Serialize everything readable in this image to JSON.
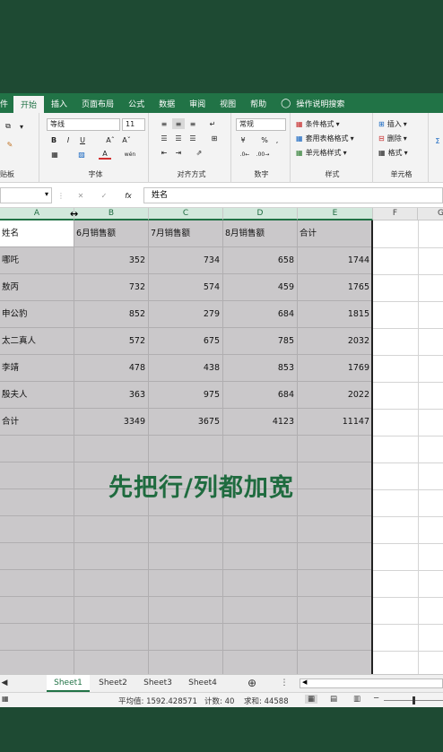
{
  "tabs": [
    "件",
    "开始",
    "插入",
    "页面布局",
    "公式",
    "数据",
    "审阅",
    "视图",
    "帮助",
    "操作说明搜索"
  ],
  "active_tab": "开始",
  "ribbon": {
    "font_name": "等线",
    "font_size": "11",
    "number_format": "常规",
    "groups": {
      "clipboard": "贴板",
      "font": "字体",
      "alignment": "对齐方式",
      "number": "数字",
      "styles": "样式",
      "cells": "单元格"
    },
    "styles_items": [
      "条件格式",
      "套用表格格式",
      "单元格样式"
    ],
    "cells_items": [
      "插入",
      "删除",
      "格式"
    ]
  },
  "formula_bar": {
    "name_box": "",
    "fx": "fx",
    "content": "姓名"
  },
  "columns": [
    "A",
    "B",
    "C",
    "D",
    "E",
    "F",
    "G"
  ],
  "headers": [
    "姓名",
    "6月销售额",
    "7月销售额",
    "8月销售额",
    "合计"
  ],
  "rows": [
    [
      "哪吒",
      "352",
      "734",
      "658",
      "1744"
    ],
    [
      "敖丙",
      "732",
      "574",
      "459",
      "1765"
    ],
    [
      "申公豹",
      "852",
      "279",
      "684",
      "1815"
    ],
    [
      "太二真人",
      "572",
      "675",
      "785",
      "2032"
    ],
    [
      "李靖",
      "478",
      "438",
      "853",
      "1769"
    ],
    [
      "殷夫人",
      "363",
      "975",
      "684",
      "2022"
    ],
    [
      "合计",
      "3349",
      "3675",
      "4123",
      "11147"
    ]
  ],
  "overlay_text": "先把行/列都加宽",
  "sheets": [
    "Sheet1",
    "Sheet2",
    "Sheet3",
    "Sheet4"
  ],
  "active_sheet": "Sheet1",
  "status": {
    "average": "平均值: 1592.428571",
    "count": "计数: 40",
    "sum": "求和: 44588"
  }
}
